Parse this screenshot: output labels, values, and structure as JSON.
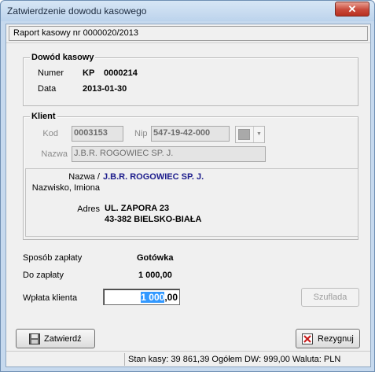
{
  "window": {
    "title": "Zatwierdzenie dowodu kasowego",
    "close_glyph": "✕"
  },
  "header": {
    "raport": "Raport kasowy nr 0000020/2013"
  },
  "dowod": {
    "legend": "Dowód kasowy",
    "numer_label": "Numer",
    "numer_prefix": "KP",
    "numer_value": "0000214",
    "data_label": "Data",
    "data_value": "2013-01-30"
  },
  "klient": {
    "legend": "Klient",
    "kod_label": "Kod",
    "kod_value": "0003153",
    "nip_label": "Nip",
    "nip_value": "547-19-42-000",
    "nazwa_label": "Nazwa",
    "nazwa_value": "J.B.R. ROGOWIEC SP. J.",
    "nazwa2_label_1": "Nazwa /",
    "nazwa2_label_2": "Nazwisko, Imiona",
    "nazwa2_value": "J.B.R. ROGOWIEC SP. J.",
    "adres_label": "Adres",
    "adres_line1": "UL. ZAPORA 23",
    "adres_line2": "43-382 BIELSKO-BIAŁA"
  },
  "payment": {
    "sposob_label": "Sposób zapłaty",
    "sposob_value": "Gotówka",
    "do_zaplaty_label": "Do zapłaty",
    "do_zaplaty_value": "1 000,00",
    "wplata_label": "Wpłata klienta",
    "wplata_selected": "1 000",
    "wplata_rest": ",00"
  },
  "buttons": {
    "szuflada": "Szuflada",
    "zatwierdz": "Zatwierdź",
    "rezygnuj": "Rezygnuj"
  },
  "status": {
    "text": "Stan kasy: 39 861,39  Ogółem DW: 999,00  Waluta: PLN"
  },
  "icons": {
    "save": "save-disk-icon",
    "cancel": "cancel-x-icon"
  },
  "colors": {
    "client_name": "#1c1c8c",
    "close_button": "#c8493a",
    "selection": "#3399ff"
  }
}
